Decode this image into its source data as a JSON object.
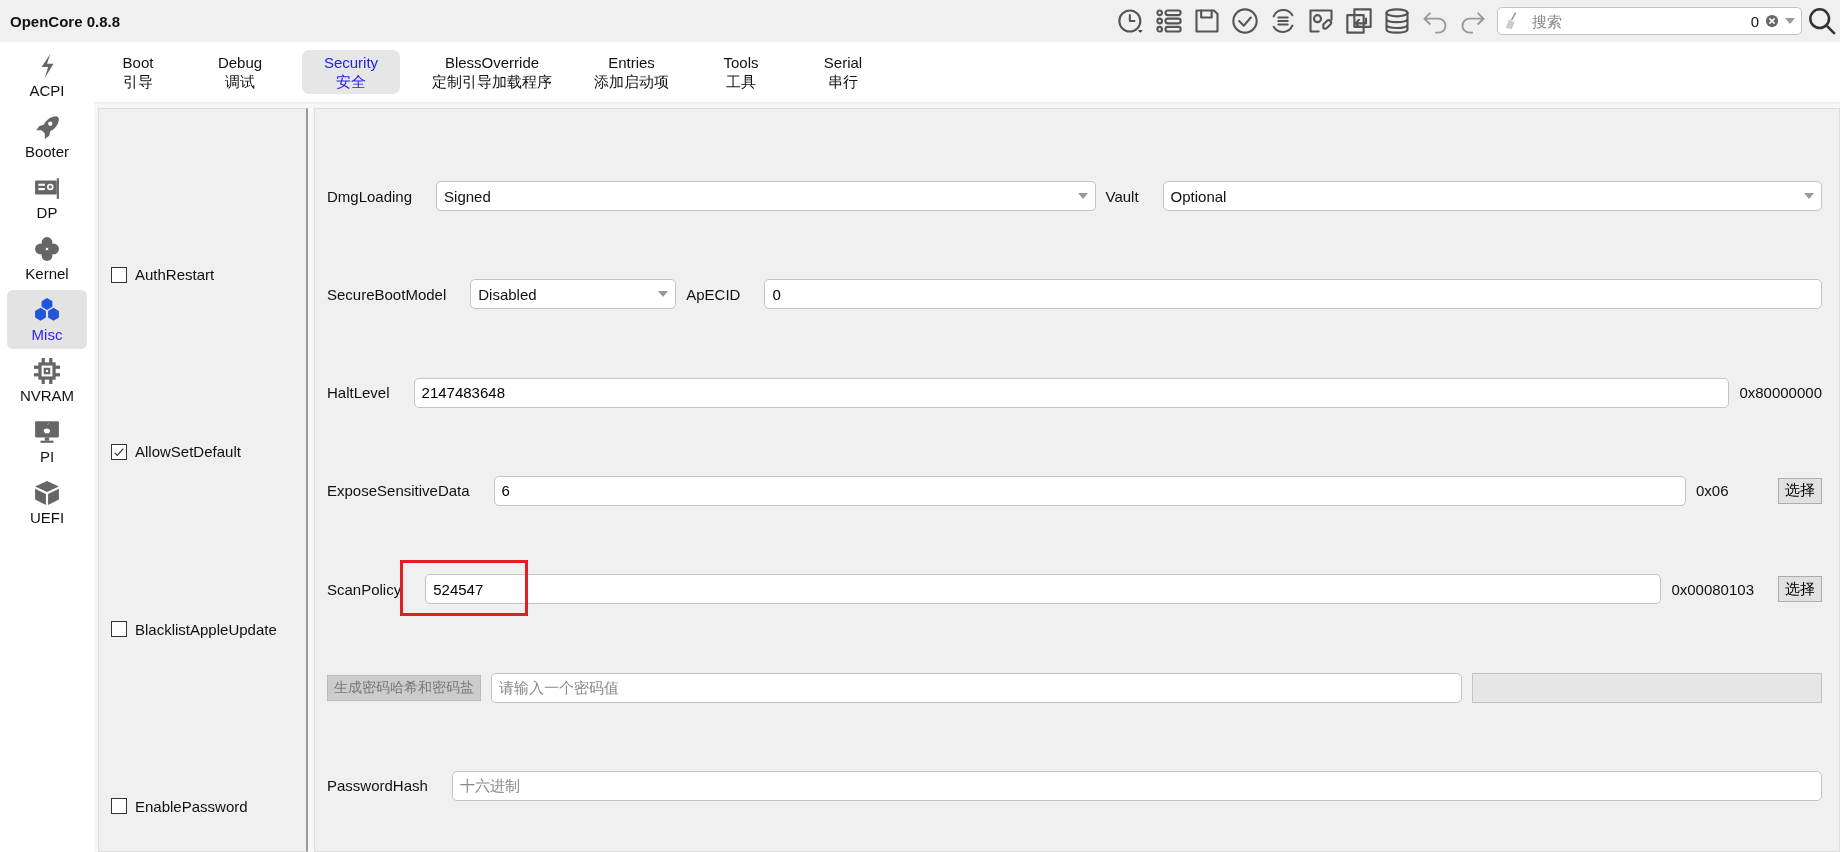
{
  "window": {
    "title": "OpenCore 0.8.8"
  },
  "search": {
    "placeholder": "搜索",
    "count": "0"
  },
  "sidebar": {
    "items": [
      {
        "label": "ACPI",
        "selected": false
      },
      {
        "label": "Booter",
        "selected": false
      },
      {
        "label": "DP",
        "selected": false
      },
      {
        "label": "Kernel",
        "selected": false
      },
      {
        "label": "Misc",
        "selected": true
      },
      {
        "label": "NVRAM",
        "selected": false
      },
      {
        "label": "PI",
        "selected": false
      },
      {
        "label": "UEFI",
        "selected": false
      }
    ]
  },
  "tabs": [
    {
      "label": "Boot",
      "sublabel": "引导",
      "selected": false
    },
    {
      "label": "Debug",
      "sublabel": "调试",
      "selected": false
    },
    {
      "label": "Security",
      "sublabel": "安全",
      "selected": true
    },
    {
      "label": "BlessOverride",
      "sublabel": "定制引导加载程序",
      "selected": false
    },
    {
      "label": "Entries",
      "sublabel": "添加启动项",
      "selected": false
    },
    {
      "label": "Tools",
      "sublabel": "工具",
      "selected": false
    },
    {
      "label": "Serial",
      "sublabel": "串行",
      "selected": false
    }
  ],
  "checkboxes": [
    {
      "label": "AuthRestart",
      "checked": false
    },
    {
      "label": "AllowSetDefault",
      "checked": true
    },
    {
      "label": "BlacklistAppleUpdate",
      "checked": false
    },
    {
      "label": "EnablePassword",
      "checked": false
    }
  ],
  "rows": [
    {
      "highlighted": false,
      "items": [
        {
          "kind": "label",
          "text": "DmgLoading"
        },
        {
          "kind": "select",
          "value": "Signed"
        },
        {
          "kind": "label",
          "text": "Vault"
        },
        {
          "kind": "select",
          "value": "Optional"
        }
      ]
    },
    {
      "highlighted": false,
      "items": [
        {
          "kind": "label",
          "text": "SecureBootModel"
        },
        {
          "kind": "compact-select",
          "value": "Disabled"
        },
        {
          "kind": "label",
          "text": "ApECID"
        },
        {
          "kind": "input",
          "value": "0"
        }
      ]
    },
    {
      "highlighted": false,
      "items": [
        {
          "kind": "label",
          "text": "HaltLevel"
        },
        {
          "kind": "input",
          "value": "2147483648"
        },
        {
          "kind": "hex",
          "text": "0x80000000"
        }
      ]
    },
    {
      "highlighted": false,
      "items": [
        {
          "kind": "label",
          "text": "ExposeSensitiveData"
        },
        {
          "kind": "input",
          "value": "6"
        },
        {
          "kind": "hex",
          "text": "0x06"
        },
        {
          "kind": "button",
          "text": "选择"
        }
      ]
    },
    {
      "highlighted": true,
      "items": [
        {
          "kind": "label",
          "text": "ScanPolicy"
        },
        {
          "kind": "input",
          "value": "524547"
        },
        {
          "kind": "hex",
          "text": "0x00080103"
        },
        {
          "kind": "button",
          "text": "选择"
        }
      ]
    },
    {
      "highlighted": false,
      "items": [
        {
          "kind": "disabled-button",
          "text": "生成密码哈希和密码盐"
        },
        {
          "kind": "input",
          "placeholder": "请输入一个密码值"
        },
        {
          "kind": "disabled-field"
        }
      ]
    },
    {
      "highlighted": false,
      "items": [
        {
          "kind": "label",
          "text": "PasswordHash"
        },
        {
          "kind": "input",
          "placeholder": "十六进制"
        }
      ]
    }
  ]
}
